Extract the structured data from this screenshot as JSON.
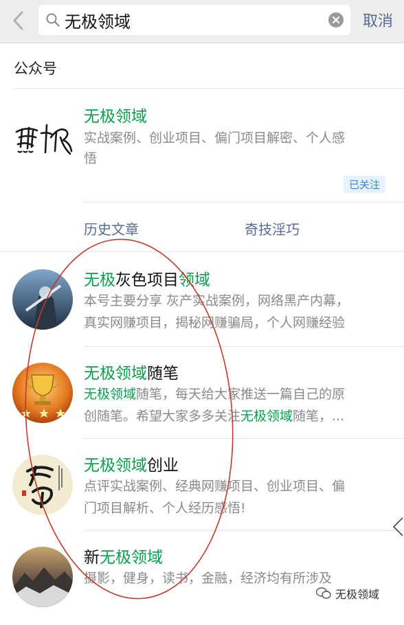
{
  "header": {
    "search_value": "无极领域",
    "cancel_label": "取消"
  },
  "section": {
    "title": "公众号"
  },
  "top_result": {
    "name": "无极领域",
    "desc_line1": "实战案例、创业项目、偏门项目解密、个人感",
    "desc_line2": "悟",
    "badge": "已关注",
    "links": [
      "历史文章",
      "奇技淫巧"
    ]
  },
  "results": [
    {
      "name_a": "无极",
      "name_b": "灰色项目",
      "name_c": "领域",
      "desc_line1": "本号主要分享 灰产实战案例，网络黑产内幕，",
      "desc_line2": "真实网赚项目，揭秘网赚骗局，个人网赚经验"
    },
    {
      "name_a": "无极领域",
      "name_b": "随笔",
      "desc_line1_a": "无极领域",
      "desc_line1_b": "随笔，每天给大家推送一篇自己的原",
      "desc_line2_a": "创随笔。希望大家多多关注",
      "desc_line2_b": "无极领域",
      "desc_line2_c": "随笔，..."
    },
    {
      "name_a": "无极领域",
      "name_b": "创业",
      "desc_line1": "点评实战案例、经典网赚项目、创业项目、偏",
      "desc_line2": "门项目解析、个人经历感悟!"
    },
    {
      "name_a": "新",
      "name_b": "无极领域",
      "desc_line1": "摄影，健身，读书，金融，经济均有所涉及"
    }
  ],
  "watermark": "无极领域",
  "colors": {
    "highlight": "#07a04a",
    "link": "#576b95",
    "header_bg": "#ededed",
    "annotation": "#c0392b"
  }
}
